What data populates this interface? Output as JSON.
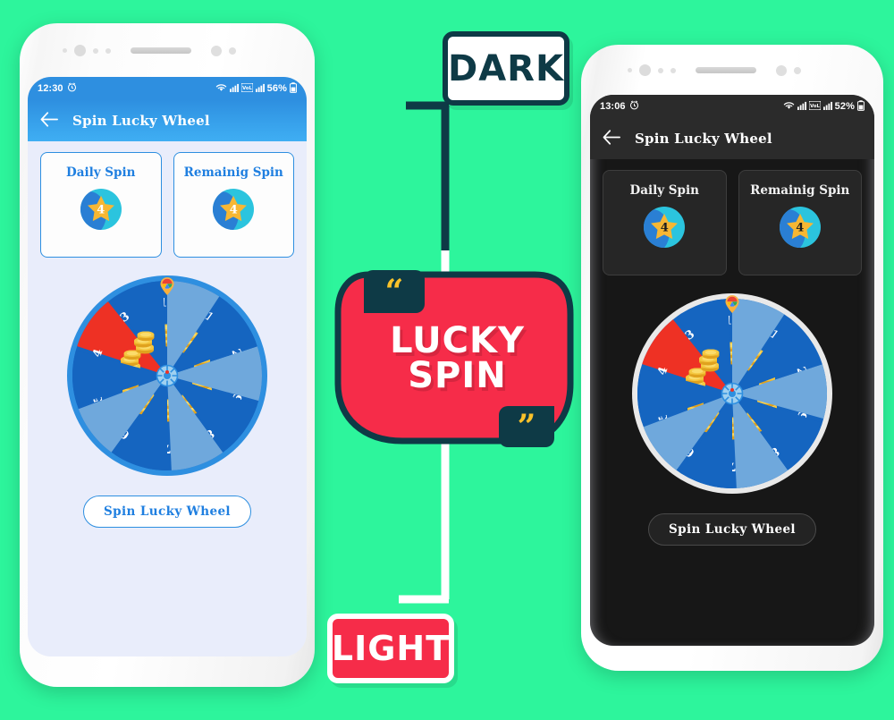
{
  "page": {
    "background_color": "#2DF59C",
    "accent_red": "#F62C49",
    "accent_teal": "#0E3A46"
  },
  "annotations": {
    "dark_label": "DARK",
    "light_label": "LIGHT",
    "badge_line1": "LUCKY",
    "badge_line2": "SPIN",
    "quote_open": "“",
    "quote_close": "”"
  },
  "phones": [
    {
      "theme": "light",
      "status_bar": {
        "time": "12:30",
        "battery": "56%",
        "icons": [
          "alarm-icon",
          "wifi-icon",
          "signal-icon",
          "volte-icon",
          "signal-icon",
          "battery-icon"
        ]
      },
      "appbar": {
        "title": "Spin Lucky Wheel",
        "back_icon": "back-arrow-icon"
      },
      "cards": [
        {
          "label": "Daily Spin",
          "value": "4"
        },
        {
          "label": "Remainig Spin",
          "value": "4"
        }
      ],
      "wheel": {
        "segments": [
          "10",
          "1",
          "2",
          "9",
          "8",
          "7",
          "6",
          "5",
          "4",
          "3"
        ],
        "highlight_segment": "10",
        "highlight_color": "#EE3124",
        "segment_color_a": "#1565C0",
        "segment_color_b": "#6FA8DC",
        "rim_color": "#2E8FE0",
        "coin_color": "#F5C842"
      },
      "spin_button": "Spin Lucky Wheel"
    },
    {
      "theme": "dark",
      "status_bar": {
        "time": "13:06",
        "battery": "52%",
        "icons": [
          "alarm-icon",
          "wifi-icon",
          "signal-icon",
          "volte-icon",
          "signal-icon",
          "battery-icon"
        ]
      },
      "appbar": {
        "title": "Spin Lucky Wheel",
        "back_icon": "back-arrow-icon"
      },
      "cards": [
        {
          "label": "Daily Spin",
          "value": "4"
        },
        {
          "label": "Remainig Spin",
          "value": "4"
        }
      ],
      "wheel": {
        "segments": [
          "10",
          "1",
          "2",
          "9",
          "8",
          "7",
          "6",
          "5",
          "4",
          "3"
        ],
        "highlight_segment": "10",
        "highlight_color": "#EE3124",
        "segment_color_a": "#1565C0",
        "segment_color_b": "#6FA8DC",
        "rim_color": "#E9E9E9",
        "coin_color": "#F5C842"
      },
      "spin_button": "Spin Lucky Wheel"
    }
  ]
}
